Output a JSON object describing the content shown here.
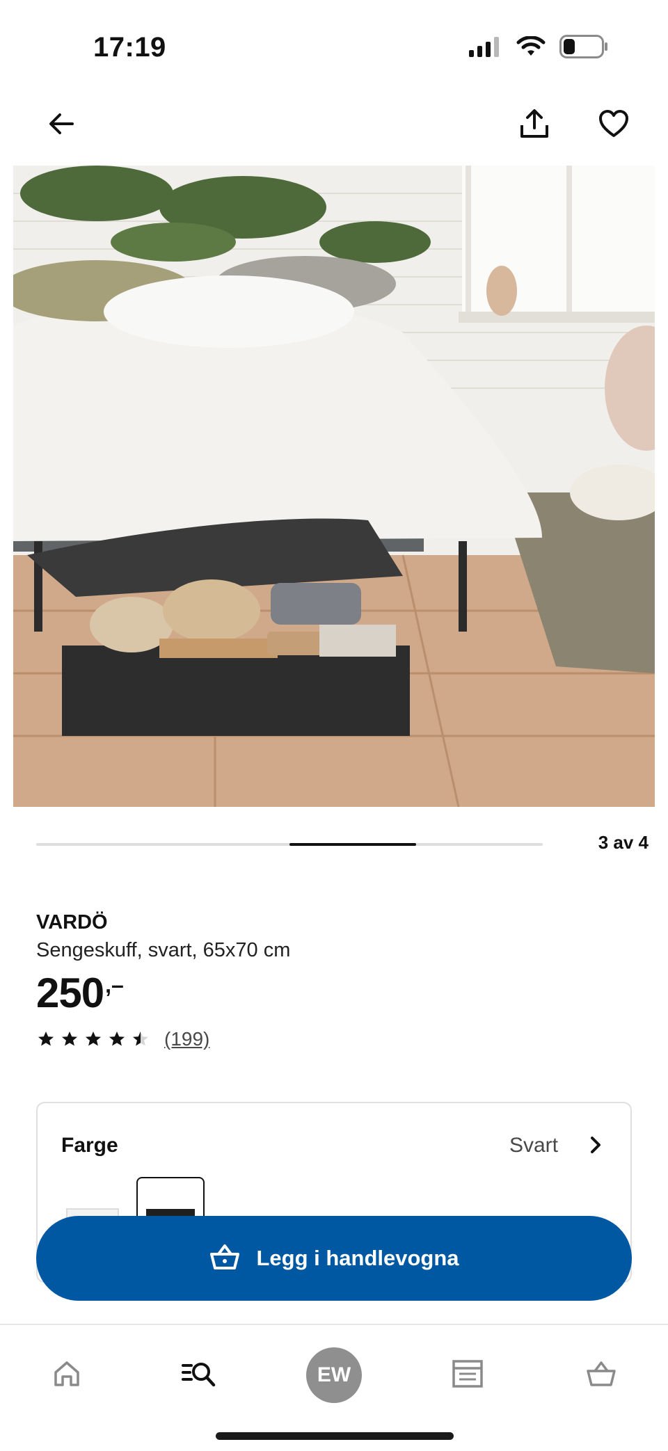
{
  "status_bar": {
    "time": "17:19",
    "icons": [
      "signal-icon",
      "wifi-icon",
      "battery-icon"
    ]
  },
  "top_nav": {
    "back_icon": "arrow-left-icon",
    "share_icon": "share-icon",
    "favorite_icon": "heart-icon"
  },
  "gallery": {
    "current": 3,
    "total": 4,
    "counter_label": "3 av 4",
    "image_subject": "under-bed-storage-drawer-photo"
  },
  "product": {
    "name": "VARDÖ",
    "description": "Sengeskuff, svart, 65x70 cm",
    "price": "250",
    "price_suffix": ",–",
    "rating": {
      "stars": 4.5,
      "max": 5,
      "count_label": "(199)"
    }
  },
  "color_selector": {
    "label": "Farge",
    "selected_value": "Svart",
    "options": [
      "white",
      "black"
    ],
    "selected_index": 1
  },
  "cart": {
    "label": "Legg i handlevogna",
    "icon": "basket-icon",
    "color": "#0058a3"
  },
  "tab_bar": {
    "avatar_initials": "EW",
    "tabs": [
      "home-icon",
      "search-list-icon",
      "profile-avatar",
      "store-icon",
      "basket-icon"
    ]
  },
  "colors": {
    "brand_blue": "#0058a3",
    "text": "#111111",
    "muted_text": "#484848",
    "divider": "#dfdfdf",
    "avatar_bg": "#8f8f8f"
  }
}
